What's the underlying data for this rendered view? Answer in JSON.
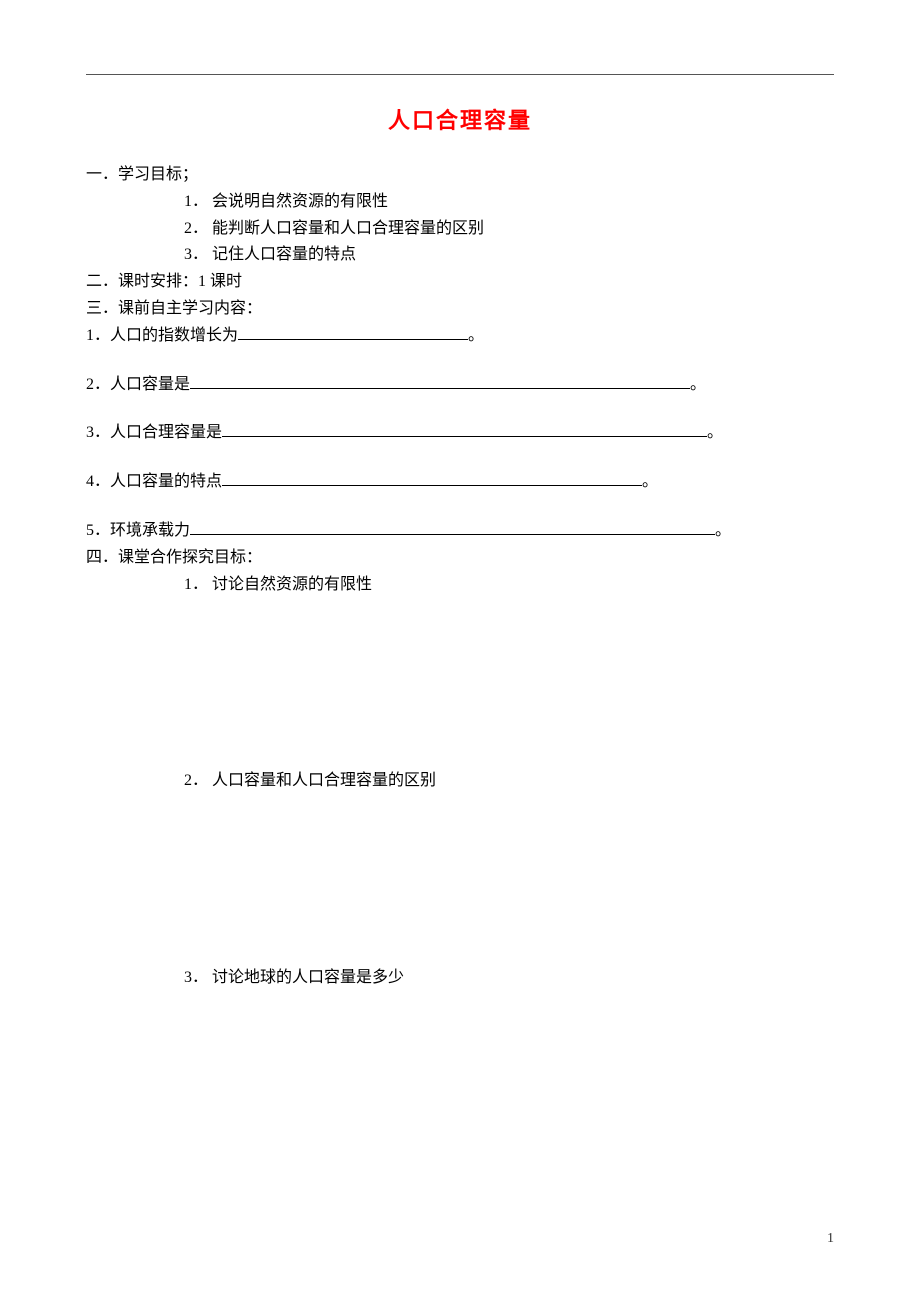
{
  "title": "人口合理容量",
  "section1": {
    "heading": "一．学习目标；",
    "items": [
      {
        "num": "1．",
        "text": "会说明自然资源的有限性"
      },
      {
        "num": "2．",
        "text": "能判断人口容量和人口合理容量的区别"
      },
      {
        "num": "3．",
        "text": "记住人口容量的特点"
      }
    ]
  },
  "section2": {
    "heading": "二．课时安排：1 课时"
  },
  "section3": {
    "heading": "三．课前自主学习内容：",
    "q1_pre": "1．人口的指数增长为",
    "q1_post": "。",
    "q2_pre": "2．人口容量是",
    "q2_post": "。",
    "q3_pre": "3．人口合理容量是",
    "q3_post": "。",
    "q4_pre": "4．人口容量的特点",
    "q4_post": "。",
    "q5_pre": "5．环境承载力",
    "q5_post": "。"
  },
  "section4": {
    "heading": "四．课堂合作探究目标：",
    "items": [
      {
        "num": "1．",
        "text": "讨论自然资源的有限性"
      },
      {
        "num": "2．",
        "text": "人口容量和人口合理容量的区别"
      },
      {
        "num": "3．",
        "text": "讨论地球的人口容量是多少"
      }
    ]
  },
  "pageNumber": "1"
}
